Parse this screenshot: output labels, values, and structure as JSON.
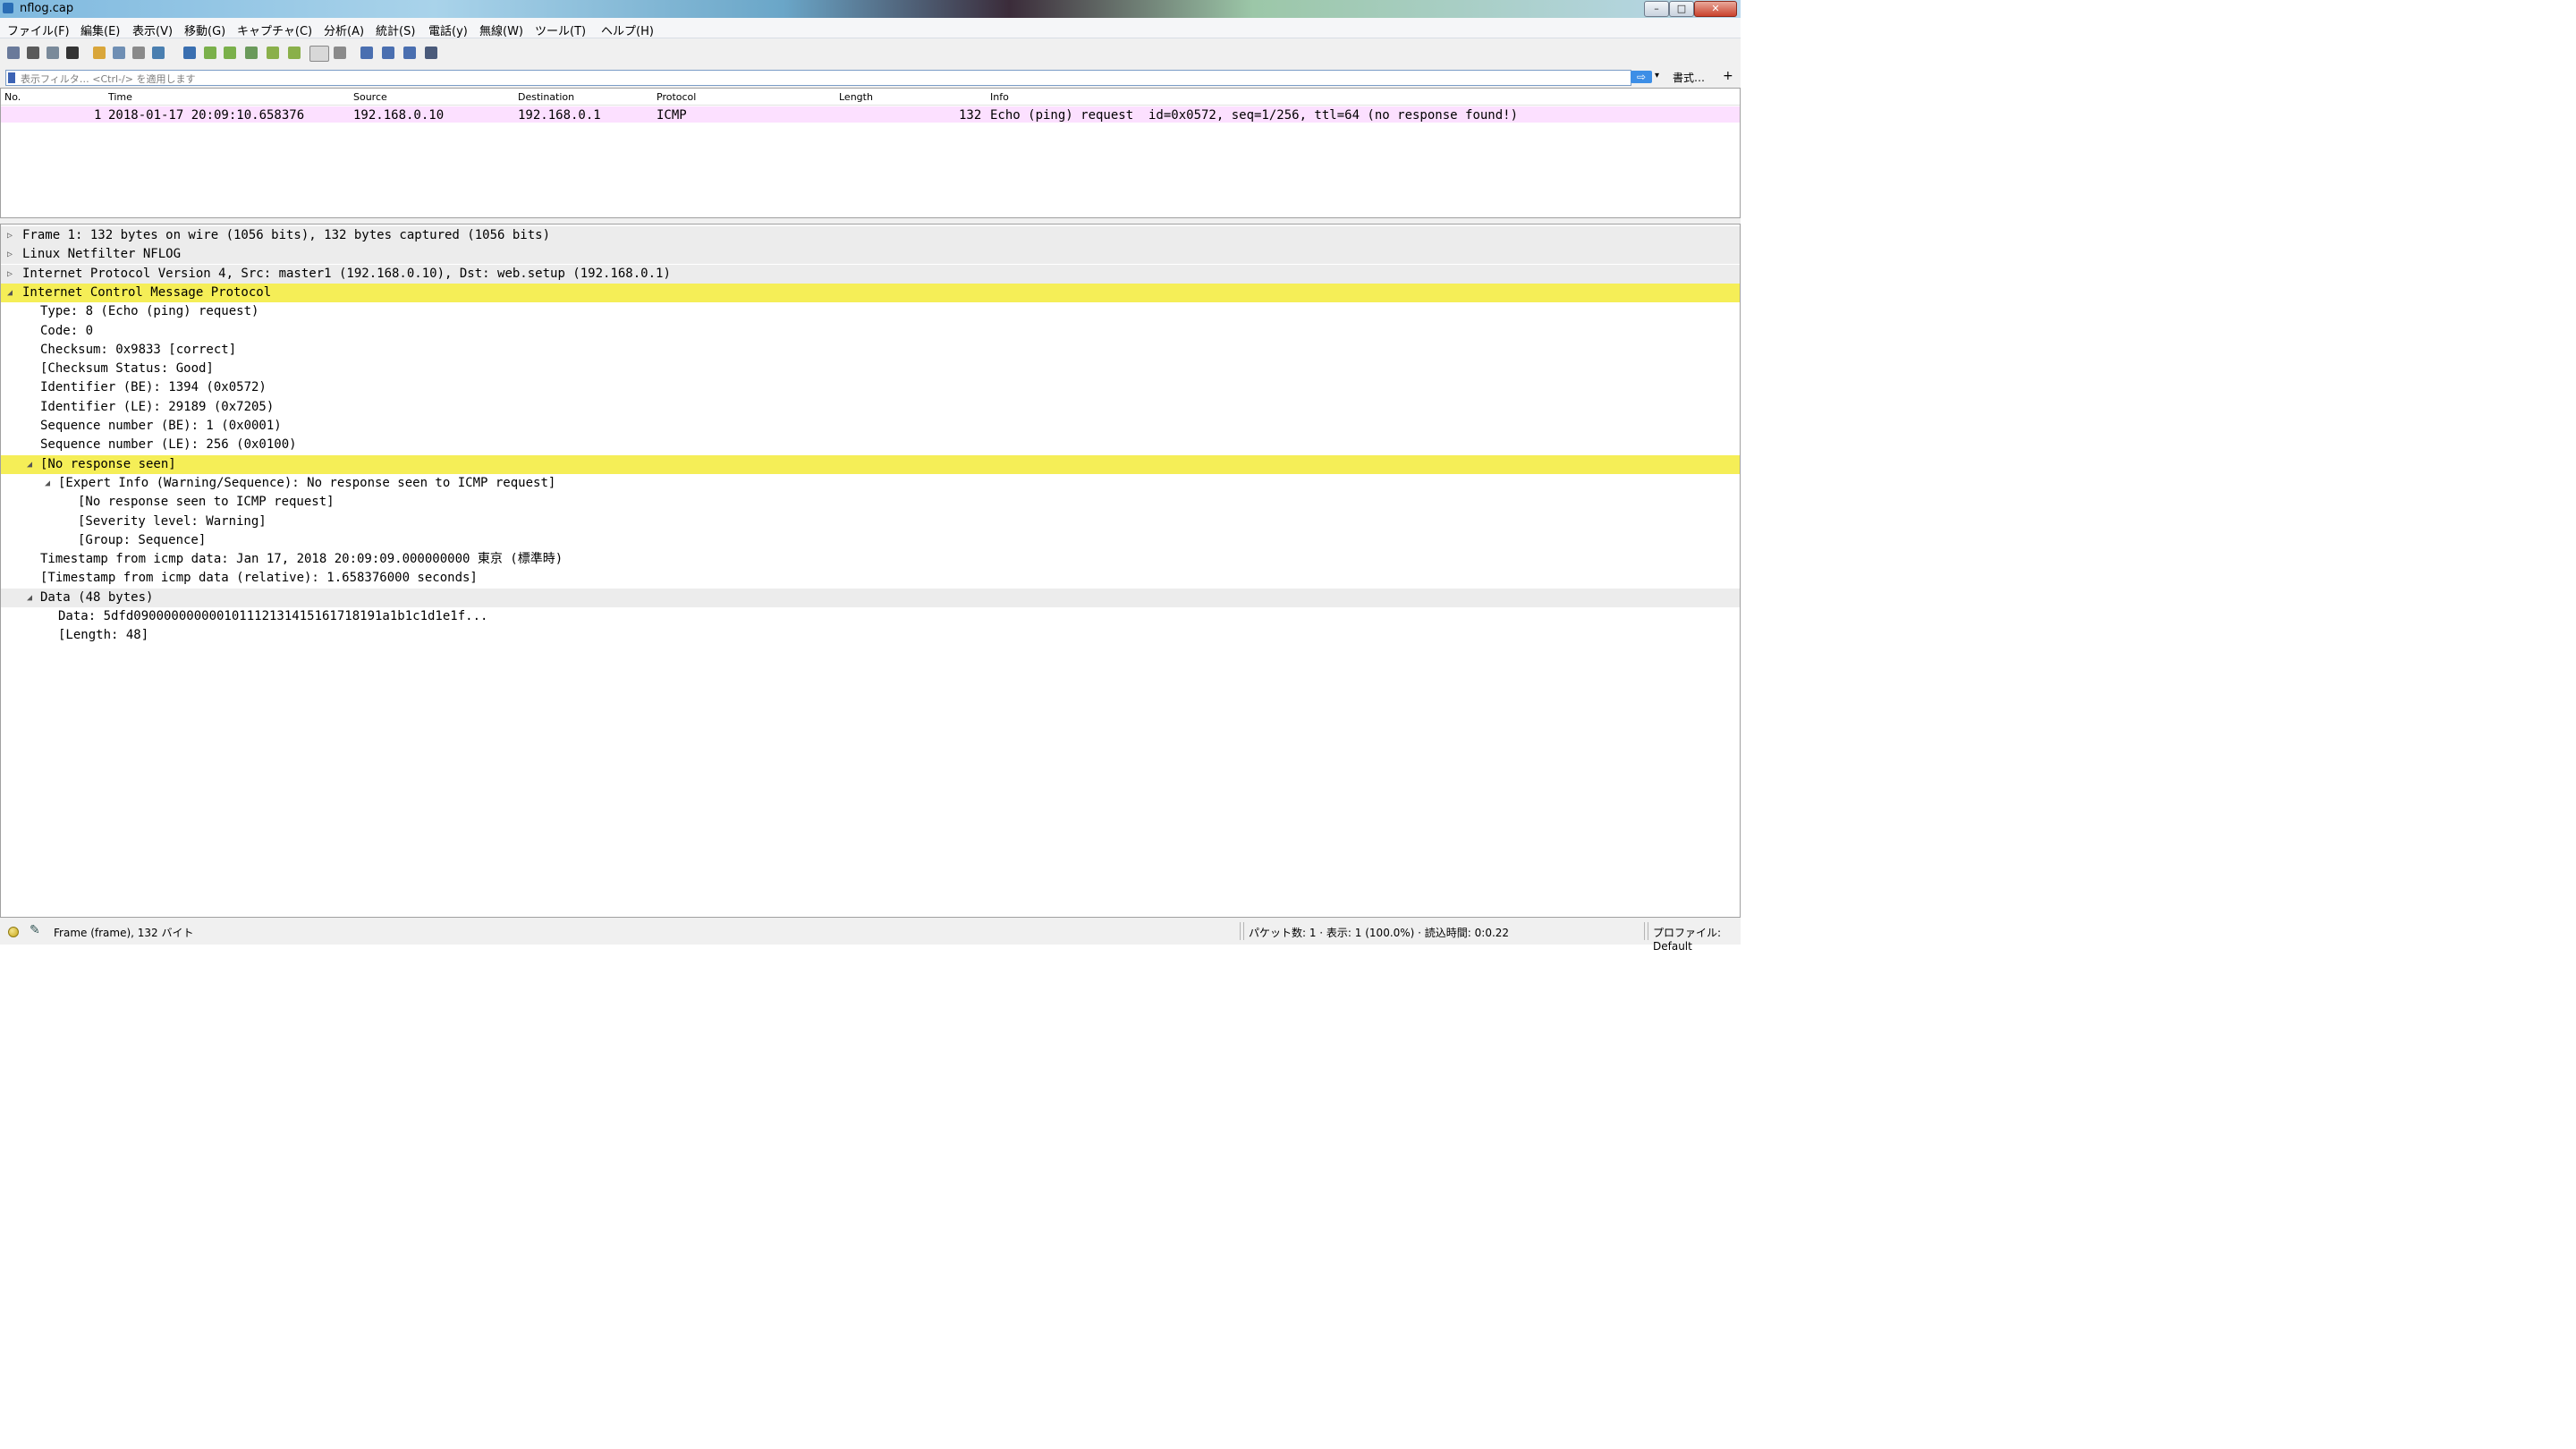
{
  "window": {
    "title": "nflog.cap",
    "min_label": "–",
    "max_label": "□",
    "close_label": "✕"
  },
  "menu": [
    "ファイル(F)",
    "編集(E)",
    "表示(V)",
    "移動(G)",
    "キャプチャ(C)",
    "分析(A)",
    "統計(S)",
    "電話(y)",
    "無線(W)",
    "ツール(T)",
    "ヘルプ(H)"
  ],
  "toolbar_icons": [
    "start-capture-icon",
    "stop-capture-icon",
    "restart-capture-icon",
    "capture-options-icon",
    "open-file-icon",
    "save-file-icon",
    "close-file-icon",
    "reload-file-icon",
    "find-packet-icon",
    "go-back-icon",
    "go-forward-icon",
    "go-to-packet-icon",
    "go-first-icon",
    "go-last-icon",
    "auto-scroll-icon",
    "colorize-icon",
    "zoom-in-icon",
    "zoom-out-icon",
    "zoom-normal-icon",
    "resize-columns-icon"
  ],
  "filter": {
    "placeholder": "表示フィルタ… <Ctrl-/> を適用します",
    "apply_label": "⇨",
    "dropdown_label": "▾",
    "format_label": "書式…",
    "add_label": "+"
  },
  "packet_list": {
    "columns": [
      "No.",
      "Time",
      "Source",
      "Destination",
      "Protocol",
      "Length",
      "Info"
    ],
    "rows": [
      {
        "no": "1",
        "time": "2018-01-17 20:09:10.658376",
        "source": "192.168.0.10",
        "destination": "192.168.0.1",
        "protocol": "ICMP",
        "length": "132",
        "info": "Echo (ping) request  id=0x0572, seq=1/256, ttl=64 (no response found!)"
      }
    ]
  },
  "details": [
    {
      "text": "Frame 1: 132 bytes on wire (1056 bits), 132 bytes captured (1056 bits)",
      "level": 0,
      "toggle": "▷",
      "style": "shade"
    },
    {
      "text": "Linux Netfilter NFLOG",
      "level": 0,
      "toggle": "▷",
      "style": "shade"
    },
    {
      "text": "Internet Protocol Version 4, Src: master1 (192.168.0.10), Dst: web.setup (192.168.0.1)",
      "level": 0,
      "toggle": "▷",
      "style": "shade"
    },
    {
      "text": "Internet Control Message Protocol",
      "level": 0,
      "toggle": "◢",
      "style": "hl"
    },
    {
      "text": "Type: 8 (Echo (ping) request)",
      "level": 1,
      "toggle": "",
      "style": ""
    },
    {
      "text": "Code: 0",
      "level": 1,
      "toggle": "",
      "style": ""
    },
    {
      "text": "Checksum: 0x9833 [correct]",
      "level": 1,
      "toggle": "",
      "style": ""
    },
    {
      "text": "[Checksum Status: Good]",
      "level": 1,
      "toggle": "",
      "style": ""
    },
    {
      "text": "Identifier (BE): 1394 (0x0572)",
      "level": 1,
      "toggle": "",
      "style": ""
    },
    {
      "text": "Identifier (LE): 29189 (0x7205)",
      "level": 1,
      "toggle": "",
      "style": ""
    },
    {
      "text": "Sequence number (BE): 1 (0x0001)",
      "level": 1,
      "toggle": "",
      "style": ""
    },
    {
      "text": "Sequence number (LE): 256 (0x0100)",
      "level": 1,
      "toggle": "",
      "style": ""
    },
    {
      "text": "[No response seen]",
      "level": 1,
      "toggle": "◢",
      "style": "hl"
    },
    {
      "text": "[Expert Info (Warning/Sequence): No response seen to ICMP request]",
      "level": 2,
      "toggle": "◢",
      "style": ""
    },
    {
      "text": "[No response seen to ICMP request]",
      "level": 3,
      "toggle": "",
      "style": ""
    },
    {
      "text": "[Severity level: Warning]",
      "level": 3,
      "toggle": "",
      "style": ""
    },
    {
      "text": "[Group: Sequence]",
      "level": 3,
      "toggle": "",
      "style": ""
    },
    {
      "text": "Timestamp from icmp data: Jan 17, 2018 20:09:09.000000000 東京 (標準時)",
      "level": 1,
      "toggle": "",
      "style": ""
    },
    {
      "text": "[Timestamp from icmp data (relative): 1.658376000 seconds]",
      "level": 1,
      "toggle": "",
      "style": ""
    },
    {
      "text": "Data (48 bytes)",
      "level": 1,
      "toggle": "◢",
      "style": "shade"
    },
    {
      "text": "Data: 5dfd0900000000001011121314151617181​91a1b1c1d1e1f...",
      "level": 2,
      "toggle": "",
      "style": ""
    },
    {
      "text": "[Length: 48]",
      "level": 2,
      "toggle": "",
      "style": ""
    }
  ],
  "status": {
    "frame_info": "Frame (frame), 132 バイト",
    "packets_info": "パケット数: 1 · 表示: 1 (100.0%) · 読込時間: 0:0.22",
    "profile": "プロファイル: Default"
  },
  "colors": {
    "highlight": "#f5ee57",
    "packet_row": "#fce0ff",
    "shaded_row": "#ececec"
  }
}
